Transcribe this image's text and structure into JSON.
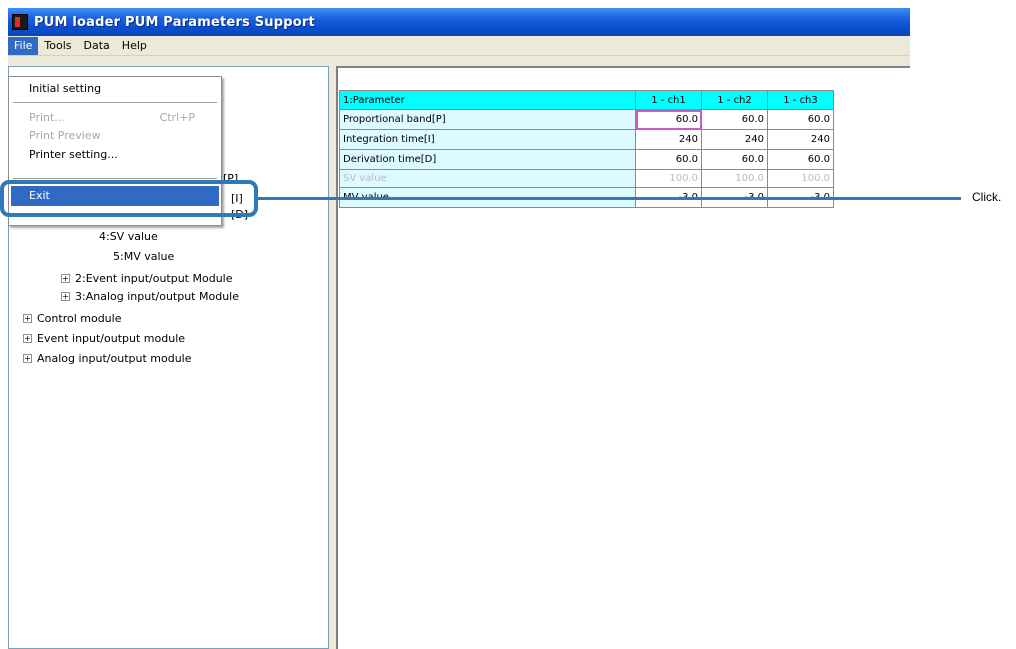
{
  "window": {
    "title": "PUM loader   PUM Parameters Support"
  },
  "menubar": {
    "items": [
      "File",
      "Tools",
      "Data",
      "Help"
    ]
  },
  "file_menu": {
    "initial_setting": "Initial setting",
    "print": "Print...",
    "print_shortcut": "Ctrl+P",
    "print_preview": "Print Preview",
    "printer_setting": "Printer setting...",
    "exit": "Exit"
  },
  "tree": {
    "partial_p": "nd[P]",
    "partial_i": "[I]",
    "partial_d": "[D]",
    "sv_value": "4:SV value",
    "mv_value": "5:MV value",
    "event_module_sub": "2:Event input/output Module",
    "analog_module_sub": "3:Analog input/output Module",
    "control_module": "Control module",
    "event_module": "Event input/output module",
    "analog_module": "Analog input/output module"
  },
  "grid": {
    "headers": [
      "1:Parameter",
      "1 - ch1",
      "1 - ch2",
      "1 - ch3"
    ],
    "rows": [
      {
        "label": "Proportional band[P]",
        "values": [
          "60.0",
          "60.0",
          "60.0"
        ]
      },
      {
        "label": "Integration time[I]",
        "values": [
          "240",
          "240",
          "240"
        ]
      },
      {
        "label": "Derivation time[D]",
        "values": [
          "60.0",
          "60.0",
          "60.0"
        ]
      },
      {
        "label": "SV value",
        "values": [
          "100.0",
          "100.0",
          "100.0"
        ]
      },
      {
        "label": "MV value",
        "values": [
          "-3.0",
          "-3.0",
          "-3.0"
        ]
      }
    ]
  },
  "annotation": {
    "callout": "Click."
  },
  "colors": {
    "titlebar": "#0a4fd0",
    "menu_highlight": "#316ac5",
    "grid_header": "#00ffff",
    "param_column": "#dcfaff",
    "callout": "#2f78b9"
  }
}
